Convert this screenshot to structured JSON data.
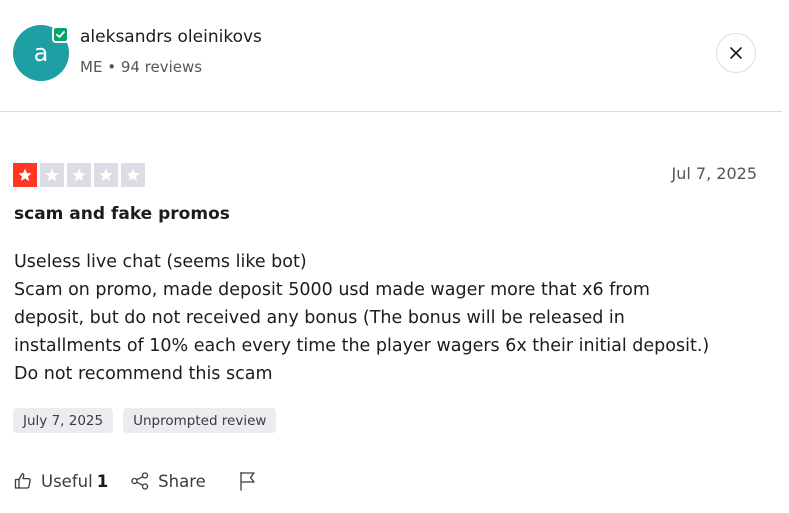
{
  "reviewer": {
    "initial": "a",
    "name": "aleksandrs oleinikovs",
    "country": "ME",
    "separator": "•",
    "reviews_count": "94 reviews",
    "avatar_color": "#1f9ea3",
    "verified_color": "#04a46b"
  },
  "review": {
    "rating": 1,
    "rating_max": 5,
    "star_active_color": "#ff3722",
    "star_inactive_color": "#dcdce6",
    "date": "Jul 7, 2025",
    "title": "scam and fake promos",
    "body_lines": [
      "Useless live chat (seems like bot)",
      "Scam on promo, made deposit 5000 usd made wager more that x6 from",
      "deposit, but do not received any bonus (The bonus will be released in",
      "installments of 10% each every time the player wagers 6x their initial deposit.)",
      "Do not recommend this scam"
    ],
    "tags": [
      "July 7, 2025",
      "Unprompted review"
    ]
  },
  "actions": {
    "useful_label": "Useful",
    "useful_count": "1",
    "share_label": "Share"
  },
  "icons": {
    "close": "close-icon",
    "verified": "verified-check-icon",
    "useful": "thumbs-up-icon",
    "share": "share-icon",
    "flag": "flag-icon"
  }
}
